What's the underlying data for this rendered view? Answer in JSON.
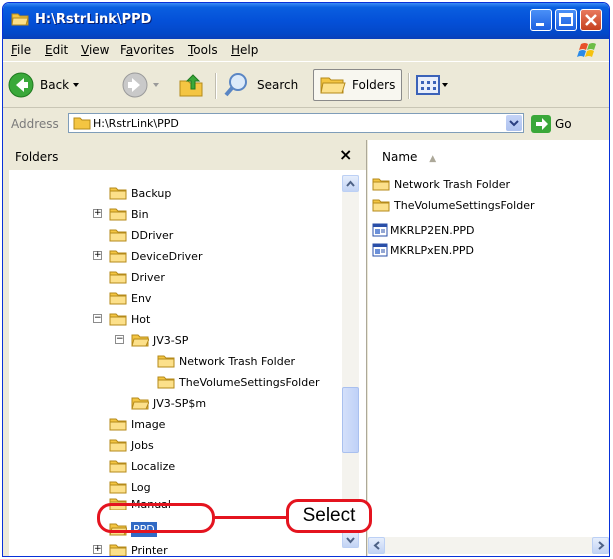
{
  "window": {
    "title": "H:\\RstrLink\\PPD",
    "icon": "folder-open-icon"
  },
  "menu": {
    "items": [
      {
        "label": "File",
        "accel": "F"
      },
      {
        "label": "Edit",
        "accel": "E"
      },
      {
        "label": "View",
        "accel": "V"
      },
      {
        "label": "Favorites",
        "accel": "a"
      },
      {
        "label": "Tools",
        "accel": "T"
      },
      {
        "label": "Help",
        "accel": "H"
      }
    ]
  },
  "toolbar": {
    "back_label": "Back",
    "search_label": "Search",
    "folders_label": "Folders"
  },
  "address": {
    "label": "Address",
    "value": "H:\\RstrLink\\PPD",
    "go_label": "Go"
  },
  "folders_pane": {
    "header": "Folders",
    "close_glyph": "×",
    "tree": [
      {
        "label": "Backup",
        "expander": ""
      },
      {
        "label": "Bin",
        "expander": "+"
      },
      {
        "label": "DDriver",
        "expander": ""
      },
      {
        "label": "DeviceDriver",
        "expander": "+"
      },
      {
        "label": "Driver",
        "expander": ""
      },
      {
        "label": "Env",
        "expander": ""
      },
      {
        "label": "Hot",
        "expander": "−"
      },
      {
        "label": "JV3-SP",
        "expander": "−"
      },
      {
        "label": "Network Trash Folder",
        "expander": ""
      },
      {
        "label": "TheVolumeSettingsFolder",
        "expander": ""
      },
      {
        "label": "JV3-SP$m",
        "expander": ""
      },
      {
        "label": "Image",
        "expander": ""
      },
      {
        "label": "Jobs",
        "expander": ""
      },
      {
        "label": "Localize",
        "expander": ""
      },
      {
        "label": "Log",
        "expander": ""
      },
      {
        "label": "Manual",
        "expander": ""
      },
      {
        "label": "PPD",
        "expander": "",
        "selected": true
      },
      {
        "label": "Printer",
        "expander": "+"
      }
    ]
  },
  "file_pane": {
    "column_name": "Name",
    "sort_indicator": "▲",
    "files": [
      {
        "label": "Network Trash Folder",
        "type": "folder"
      },
      {
        "label": "TheVolumeSettingsFolder",
        "type": "folder"
      },
      {
        "label": "MKRLP2EN.PPD",
        "type": "ppd"
      },
      {
        "label": "MKRLPxEN.PPD",
        "type": "ppd"
      }
    ]
  },
  "callout": {
    "label": "Select",
    "color": "#e4141f"
  },
  "colors": {
    "titlebar": "#0450d8",
    "selection": "#316ac5",
    "folder": "#f4c542"
  }
}
